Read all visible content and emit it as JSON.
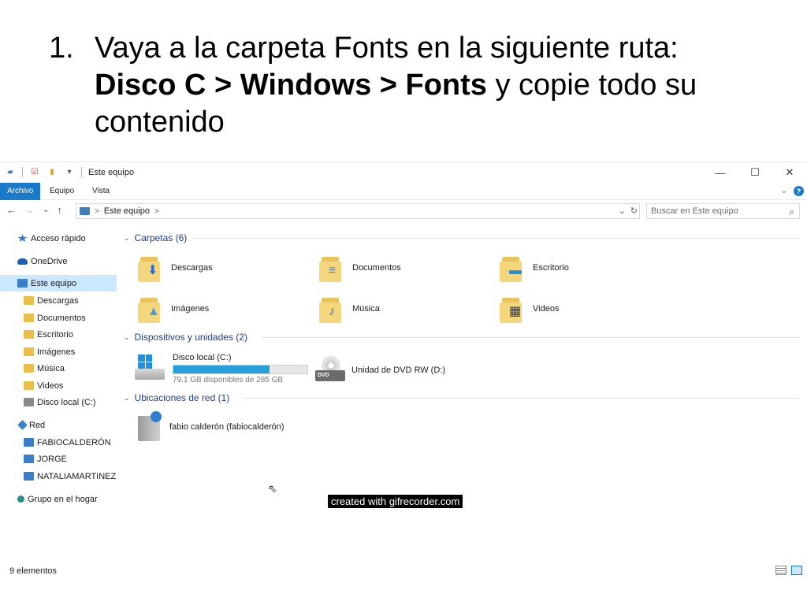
{
  "slide": {
    "number": "1.",
    "line1": "Vaya a la carpeta Fonts en la siguiente ruta:",
    "path_bold": "Disco C > Windows > Fonts",
    "line2_rest": " y copie todo su contenido"
  },
  "window": {
    "title": "Este equipo",
    "caption_buttons": {
      "minimize": "—",
      "maximize": "☐",
      "close": "✕"
    },
    "ribbon_tabs": [
      "Archivo",
      "Equipo",
      "Vista"
    ],
    "ribbon_expand": "⌄",
    "help": "?"
  },
  "navigation": {
    "back": "←",
    "forward": "→",
    "recent": "⌄",
    "up": "↑",
    "address_sep": ">",
    "address": "Este equipo",
    "address_dropdown": "⌄",
    "refresh": "↻",
    "search_placeholder": "Buscar en Este equipo",
    "search_icon": "search-icon"
  },
  "sidebar": {
    "items": [
      {
        "label": "Acceso rápido",
        "icon": "star-icon"
      },
      {
        "label": "OneDrive",
        "icon": "cloud-icon"
      },
      {
        "label": "Este equipo",
        "icon": "computer-icon",
        "selected": true
      },
      {
        "label": "Descargas",
        "icon": "download-folder-icon"
      },
      {
        "label": "Documentos",
        "icon": "documents-folder-icon"
      },
      {
        "label": "Escritorio",
        "icon": "desktop-folder-icon"
      },
      {
        "label": "Imágenes",
        "icon": "pictures-folder-icon"
      },
      {
        "label": "Música",
        "icon": "music-folder-icon"
      },
      {
        "label": "Videos",
        "icon": "videos-folder-icon"
      },
      {
        "label": "Disco local (C:)",
        "icon": "drive-icon"
      },
      {
        "label": "Red",
        "icon": "network-icon"
      },
      {
        "label": "FABIOCALDERÓN",
        "icon": "network-computer-icon"
      },
      {
        "label": "JORGE",
        "icon": "network-computer-icon"
      },
      {
        "label": "NATALIAMARTINEZ",
        "icon": "network-computer-icon"
      },
      {
        "label": "Grupo en el hogar",
        "icon": "homegroup-icon"
      }
    ]
  },
  "content": {
    "folders_header": "Carpetas (6)",
    "folders": [
      {
        "label": "Descargas",
        "glyph": "⬇",
        "glyph_color": "#1f6fd1"
      },
      {
        "label": "Documentos",
        "glyph": "≡",
        "glyph_color": "#5b7fb0"
      },
      {
        "label": "Escritorio",
        "glyph": "▬",
        "glyph_color": "#1e8fe0"
      },
      {
        "label": "Imágenes",
        "glyph": "▲",
        "glyph_color": "#4a9ad8"
      },
      {
        "label": "Música",
        "glyph": "♪",
        "glyph_color": "#1f6fd1"
      },
      {
        "label": "Videos",
        "glyph": "▦",
        "glyph_color": "#333333"
      }
    ],
    "devices_header": "Dispositivos y unidades (2)",
    "drive_c": {
      "label": "Disco local (C:)",
      "free_text": "79.1 GB disponibles de 285 GB",
      "used_fraction": 0.72
    },
    "dvd": {
      "label": "Unidad de DVD RW (D:)",
      "badge": "DVD"
    },
    "network_header": "Ubicaciones de red (1)",
    "network_location": {
      "label": "fabio calderón (fabiocalderón)"
    }
  },
  "watermark": "created with gifrecorder.com",
  "status": {
    "items_count": "9 elementos"
  }
}
